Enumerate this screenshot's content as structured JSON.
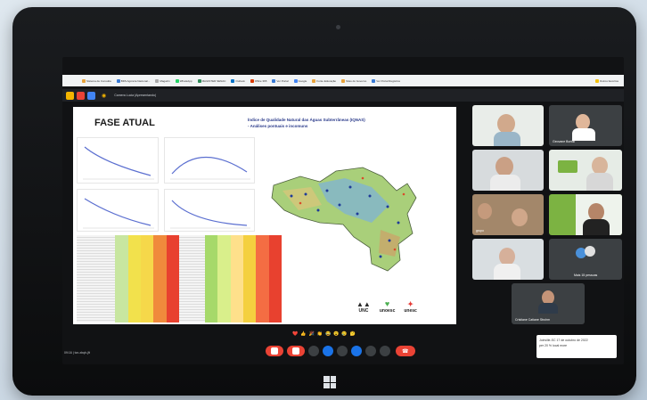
{
  "browser": {
    "bookmarks": [
      "Sistema de Consulta",
      "BDS Agência Nacional...",
      "Magazin",
      "WhatsApp",
      "MAGISTER SENAC",
      "Outlook",
      "Office 365",
      "Ver Portal",
      "Google",
      "Fonte Educação",
      "Sites do Governo",
      "Ver Portal Registros",
      "Outros favoritos"
    ]
  },
  "meet": {
    "title": "Camera Lucia (Apresentando)",
    "time": "09:16 | tcn-xbqh-jft"
  },
  "slide": {
    "title": "FASE ATUAL",
    "subtitle_line1": "Índice de Qualidade Natural das Águas Subterrâneas (IQNAS)",
    "subtitle_line2": "- Análises pontuais e incomuns",
    "logos": [
      "UNC",
      "unoesc",
      "unesc"
    ]
  },
  "participants": [
    {
      "name": ""
    },
    {
      "name": "Geovane Bortoli"
    },
    {
      "name": ""
    },
    {
      "name": ""
    },
    {
      "name": "grupo"
    },
    {
      "name": ""
    },
    {
      "name": ""
    },
    {
      "name": "Mais 15 pessoas"
    },
    {
      "name": "Cristiane Catiane Strohm"
    }
  ],
  "reactions": [
    "❤️",
    "👍",
    "🎉",
    "👏",
    "😂",
    "😮",
    "😢",
    "🤔"
  ],
  "chat": {
    "line1": "Joinville-SC 17 de outubro de 2022",
    "line2": "per 20 % local more"
  },
  "colors": {
    "accent": "#1a73e8",
    "leave": "#ea4335",
    "screen_bg": "#111214"
  }
}
